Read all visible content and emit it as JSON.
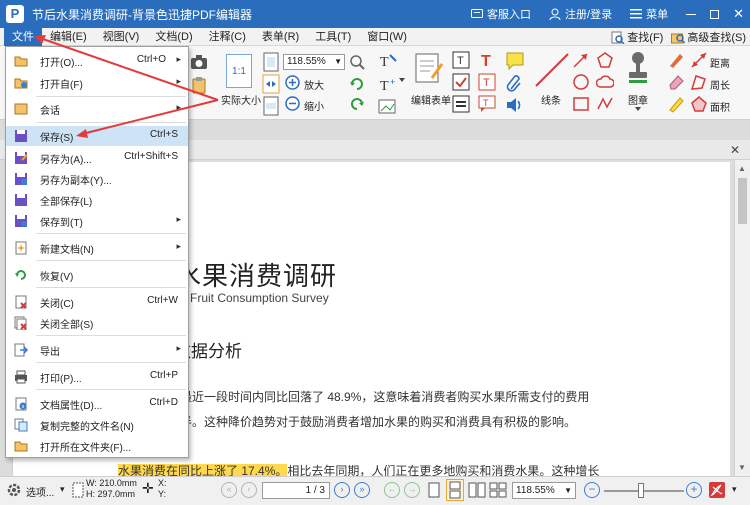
{
  "window": {
    "title": "节后水果消费调研-背景色迅捷PDF编辑器",
    "logo": "P",
    "customer_entry": "客服入口",
    "register_login": "注册/登录",
    "menu": "菜单"
  },
  "menubar": {
    "items": [
      "文件",
      "编辑(E)",
      "视图(V)",
      "文档(D)",
      "注释(C)",
      "表单(R)",
      "工具(T)",
      "窗口(W)"
    ],
    "find": "查找(F)",
    "advanced_find": "高级查找(S)"
  },
  "ribbon": {
    "zoom_value": "118.55%",
    "zoom_in": "放大",
    "zoom_out": "缩小",
    "actual_size": "实际大小",
    "edit_form": "编辑表单",
    "line": "线条",
    "stamp": "图章",
    "distance": "距离",
    "perimeter": "周长",
    "area": "面积",
    "actual_size_icon_text": "1:1"
  },
  "file_menu": [
    {
      "label": "打开(O)...",
      "shortcut": "Ctrl+O",
      "submenu": true,
      "icon": "open-folder-icon"
    },
    {
      "label": "打开自(F)",
      "shortcut": "",
      "submenu": true,
      "icon": "open-from-icon"
    },
    {
      "label": "会话",
      "shortcut": "",
      "submenu": true,
      "icon": "session-icon"
    },
    {
      "label": "保存(S)",
      "shortcut": "Ctrl+S",
      "submenu": false,
      "icon": "save-icon"
    },
    {
      "label": "另存为(A)...",
      "shortcut": "Ctrl+Shift+S",
      "submenu": false,
      "icon": "save-as-icon"
    },
    {
      "label": "另存为副本(Y)...",
      "shortcut": "",
      "submenu": false,
      "icon": "save-copy-icon"
    },
    {
      "label": "全部保存(L)",
      "shortcut": "",
      "submenu": false,
      "icon": "save-all-icon"
    },
    {
      "label": "保存到(T)",
      "shortcut": "",
      "submenu": true,
      "icon": "save-to-icon"
    },
    {
      "label": "新建文档(N)",
      "shortcut": "",
      "submenu": true,
      "icon": "new-doc-icon"
    },
    {
      "label": "恢复(V)",
      "shortcut": "",
      "submenu": false,
      "icon": "restore-icon"
    },
    {
      "label": "关闭(C)",
      "shortcut": "Ctrl+W",
      "submenu": false,
      "icon": "close-doc-icon"
    },
    {
      "label": "关闭全部(S)",
      "shortcut": "",
      "submenu": false,
      "icon": "close-all-icon"
    },
    {
      "label": "导出",
      "shortcut": "",
      "submenu": true,
      "icon": "export-icon"
    },
    {
      "label": "打印(P)...",
      "shortcut": "Ctrl+P",
      "submenu": false,
      "icon": "print-icon"
    },
    {
      "label": "文档属性(D)...",
      "shortcut": "Ctrl+D",
      "submenu": false,
      "icon": "doc-properties-icon"
    },
    {
      "label": "复制完整的文件名(N)",
      "shortcut": "",
      "submenu": false,
      "icon": "copy-filename-icon"
    },
    {
      "label": "打开所在文件夹(F)...",
      "shortcut": "",
      "submenu": false,
      "icon": "open-containing-folder-icon"
    }
  ],
  "document": {
    "title": "水果消费调研",
    "subtitle": "Fruit Consumption Survey",
    "heading": "数据分析",
    "para1_line1": "最近一段时间内同比回落了 48.9%，这意味着消费者购买水果所需支付的费用",
    "para1_line2": "半。这种降价趋势对于鼓励消费者增加水果的购买和消费具有积极的影响。",
    "para2_highlight": "水果消费在同比上涨了 17.4%。",
    "para2_rest": "相比去年同期，人们正在更多地购买和消费水果。这种增长"
  },
  "statusbar": {
    "options": "选项...",
    "width": "W: 210.0mm",
    "height": "H: 297.0mm",
    "x": "X:",
    "y": "Y:",
    "page": "1 / 3",
    "zoom": "118.55%"
  },
  "colors": {
    "titlebar": "#2a6dbd",
    "highlight": "#ffd84d",
    "arrow": "#e23b3b"
  }
}
